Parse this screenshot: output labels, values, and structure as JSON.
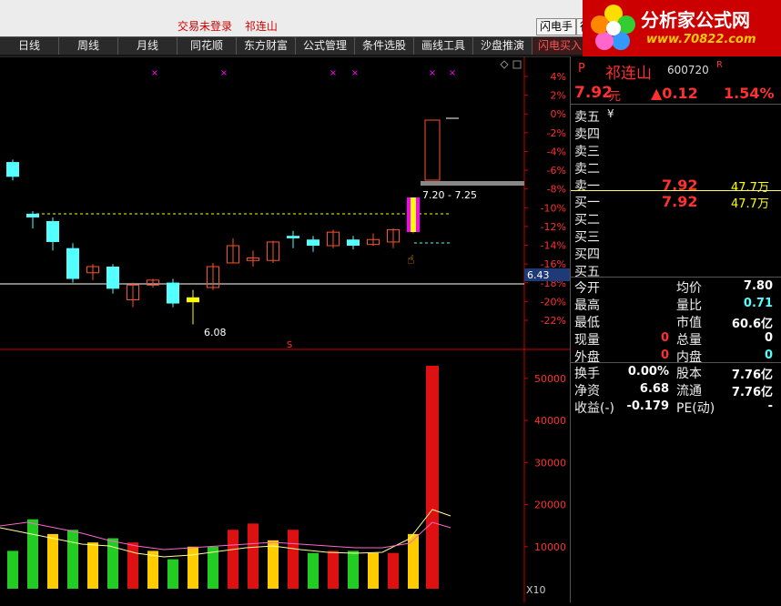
{
  "topbar": {
    "status_not_logged": "交易未登录",
    "status_stock": "祁连山",
    "btn_flash": "闪电手",
    "btn_row": "行"
  },
  "nav": [
    {
      "label": "日线"
    },
    {
      "label": "周线"
    },
    {
      "label": "月线"
    },
    {
      "label": "同花顺"
    },
    {
      "label": "东方财富"
    },
    {
      "label": "公式管理"
    },
    {
      "label": "条件选股"
    },
    {
      "label": "画线工具"
    },
    {
      "label": "沙盘推演"
    },
    {
      "label": "闪电买入",
      "active": true
    }
  ],
  "logo": {
    "title": "分析家公式网",
    "url": "www.70822.com"
  },
  "chart": {
    "pct_ticks": [
      "4%",
      "2%",
      "0%",
      "-2%",
      "-4%",
      "-6%",
      "-8%",
      "-10%",
      "-12%",
      "-14%",
      "-16%",
      "-18%",
      "-20%",
      "-22%"
    ],
    "vol_ticks": [
      "50000",
      "40000",
      "30000",
      "20000",
      "10000"
    ],
    "range_label": "7.20 - 7.25",
    "low_label": "6.08",
    "price_tag": "6.43",
    "marker": "S",
    "scale": "X10",
    "colors": {
      "up": "#ff5028",
      "down": "#54ffff",
      "yellow": "#ffff00",
      "magenta": "#ff00ff"
    }
  },
  "chart_data": {
    "type": "candlestick",
    "candles": [
      {
        "o": 7.4,
        "c": 7.28,
        "h": 7.42,
        "l": 7.25
      },
      {
        "o": 6.98,
        "c": 6.95,
        "h": 7.0,
        "l": 6.86
      },
      {
        "o": 6.92,
        "c": 6.75,
        "h": 6.95,
        "l": 6.68
      },
      {
        "o": 6.7,
        "c": 6.45,
        "h": 6.74,
        "l": 6.42
      },
      {
        "o": 6.5,
        "c": 6.55,
        "h": 6.57,
        "l": 6.44
      },
      {
        "o": 6.55,
        "c": 6.37,
        "h": 6.57,
        "l": 6.33
      },
      {
        "o": 6.28,
        "c": 6.4,
        "h": 6.42,
        "l": 6.22
      },
      {
        "o": 6.4,
        "c": 6.44,
        "h": 6.45,
        "l": 6.38
      },
      {
        "o": 6.42,
        "c": 6.25,
        "h": 6.45,
        "l": 6.22
      },
      {
        "o": 6.3,
        "c": 6.26,
        "h": 6.36,
        "l": 6.08
      },
      {
        "o": 6.38,
        "c": 6.55,
        "h": 6.58,
        "l": 6.36
      },
      {
        "o": 6.58,
        "c": 6.72,
        "h": 6.78,
        "l": 6.58
      },
      {
        "o": 6.6,
        "c": 6.62,
        "h": 6.68,
        "l": 6.55
      },
      {
        "o": 6.6,
        "c": 6.75,
        "h": 6.76,
        "l": 6.58
      },
      {
        "o": 6.8,
        "c": 6.78,
        "h": 6.84,
        "l": 6.7
      },
      {
        "o": 6.77,
        "c": 6.72,
        "h": 6.8,
        "l": 6.67
      },
      {
        "o": 6.72,
        "c": 6.83,
        "h": 6.85,
        "l": 6.7
      },
      {
        "o": 6.77,
        "c": 6.72,
        "h": 6.8,
        "l": 6.69
      },
      {
        "o": 6.73,
        "c": 6.77,
        "h": 6.82,
        "l": 6.72
      },
      {
        "o": 6.75,
        "c": 6.85,
        "h": 6.86,
        "l": 6.7
      },
      {
        "o": 6.85,
        "c": 7.04,
        "h": 7.1,
        "l": 6.82
      },
      {
        "o": 7.28,
        "c": 7.92,
        "h": 7.93,
        "l": 7.28
      }
    ],
    "volume": [
      9000,
      16500,
      13000,
      14000,
      11000,
      12000,
      11000,
      9000,
      7000,
      10000,
      10000,
      14000,
      15500,
      11500,
      14000,
      8500,
      9000,
      9000,
      8500,
      8500,
      13000,
      21000,
      53000
    ],
    "ylim": [
      6.0,
      8.2
    ]
  },
  "quote": {
    "code_prefix": "P",
    "name": "祁连山",
    "code": "600720",
    "code_suffix": "R",
    "price": "7.92",
    "price_unit": "元",
    "change": "▲0.12",
    "pct": "1.54%",
    "asks": [
      {
        "label": "卖五",
        "mark": "¥",
        "price": "",
        "vol": ""
      },
      {
        "label": "卖四",
        "price": "",
        "vol": ""
      },
      {
        "label": "卖三",
        "price": "",
        "vol": ""
      },
      {
        "label": "卖二",
        "price": "",
        "vol": ""
      },
      {
        "label": "卖一",
        "price": "7.92",
        "vol": "47.7万"
      }
    ],
    "bids": [
      {
        "label": "买一",
        "price": "7.92",
        "vol": "47.7万"
      },
      {
        "label": "买二",
        "price": "",
        "vol": ""
      },
      {
        "label": "买三",
        "price": "",
        "vol": ""
      },
      {
        "label": "买四",
        "price": "",
        "vol": ""
      },
      {
        "label": "买五",
        "price": "",
        "vol": ""
      }
    ],
    "stats": [
      {
        "l1": "今开",
        "v1": "",
        "l2": "均价",
        "v2": "7.80"
      },
      {
        "l1": "最高",
        "v1": "",
        "l2": "量比",
        "v2": "0.71"
      },
      {
        "l1": "最低",
        "v1": "",
        "l2": "市值",
        "v2": "60.6亿"
      },
      {
        "l1": "现量",
        "v1": "0",
        "l2": "总量",
        "v2": "0"
      },
      {
        "l1": "外盘",
        "v1": "0",
        "l2": "内盘",
        "v2": "0"
      }
    ],
    "fin": [
      {
        "l1": "换手",
        "v1": "0.00%",
        "l2": "股本",
        "v2": "7.76亿"
      },
      {
        "l1": "净资",
        "v1": "6.68",
        "l2": "流通",
        "v2": "7.76亿"
      },
      {
        "l1": "收益(-)",
        "v1": "-0.179",
        "l2": "PE(动)",
        "v2": "-"
      }
    ]
  }
}
